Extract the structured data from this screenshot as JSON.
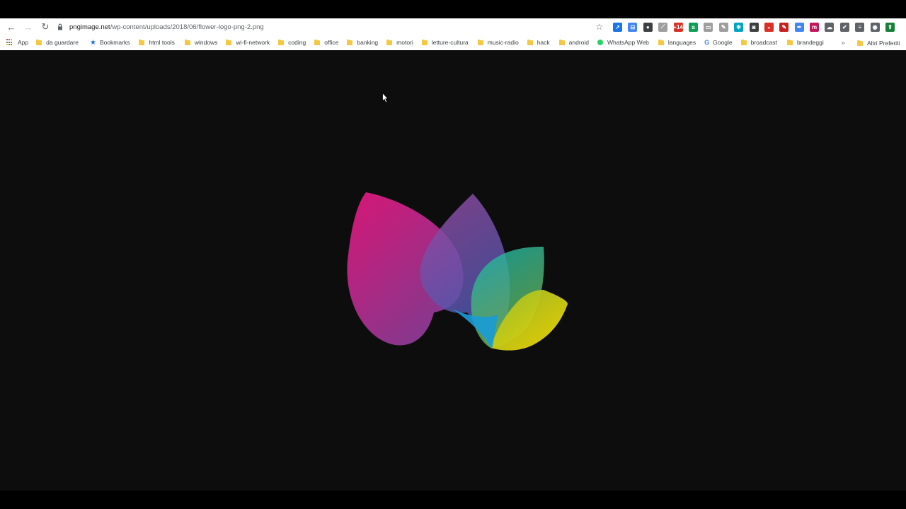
{
  "browser": {
    "url_host": "pngimage.net",
    "url_path": "/wp-content/uploads/2018/06/flower-logo-png-2.png"
  },
  "extensions": [
    {
      "name": "arrow-ext-icon",
      "color": "#1a73e8",
      "glyph": "↗"
    },
    {
      "name": "doc-ext-icon",
      "color": "#4285f4",
      "glyph": "⊟"
    },
    {
      "name": "circle-ext-icon",
      "color": "#3c4043",
      "glyph": "●"
    },
    {
      "name": "pdf-ext-icon",
      "color": "#9e9e9e",
      "glyph": "⟋"
    },
    {
      "name": "badge-ext-icon",
      "color": "#d93025",
      "glyph": "+14"
    },
    {
      "name": "a-ext-icon",
      "color": "#0f9d58",
      "glyph": "a"
    },
    {
      "name": "screen-ext-icon",
      "color": "#9e9e9e",
      "glyph": "▭"
    },
    {
      "name": "pen-ext-icon",
      "color": "#9e9e9e",
      "glyph": "✎"
    },
    {
      "name": "react-ext-icon",
      "color": "#00a3c4",
      "glyph": "✻"
    },
    {
      "name": "camera-ext-icon",
      "color": "#3c4043",
      "glyph": "◙"
    },
    {
      "name": "pokeball-ext-icon",
      "color": "#d93025",
      "glyph": "◒"
    },
    {
      "name": "acrobat-ext-icon",
      "color": "#c5221f",
      "glyph": "✎"
    },
    {
      "name": "feather-ext-icon",
      "color": "#4285f4",
      "glyph": "✒"
    },
    {
      "name": "m-ext-icon",
      "color": "#c2185b",
      "glyph": "m"
    },
    {
      "name": "cloud-ext-icon",
      "color": "#5f6368",
      "glyph": "☁"
    },
    {
      "name": "check-ext-icon",
      "color": "#5f6368",
      "glyph": "✔"
    },
    {
      "name": "list-ext-icon",
      "color": "#5f6368",
      "glyph": "≡"
    },
    {
      "name": "profile-ext-icon",
      "color": "#5f6368",
      "glyph": "◉"
    },
    {
      "name": "update-ext-icon",
      "color": "#188038",
      "glyph": "⬆"
    }
  ],
  "bookmarks": {
    "apps": "App",
    "items": [
      {
        "label": "da guardare",
        "type": "folder"
      },
      {
        "label": "Bookmarks",
        "type": "star"
      },
      {
        "label": "html tools",
        "type": "folder"
      },
      {
        "label": "windows",
        "type": "folder"
      },
      {
        "label": "wi-fi-network",
        "type": "folder"
      },
      {
        "label": "coding",
        "type": "folder"
      },
      {
        "label": "office",
        "type": "folder"
      },
      {
        "label": "banking",
        "type": "folder"
      },
      {
        "label": "motori",
        "type": "folder"
      },
      {
        "label": "letture-cultura",
        "type": "folder"
      },
      {
        "label": "music-radio",
        "type": "folder"
      },
      {
        "label": "hack",
        "type": "folder"
      },
      {
        "label": "android",
        "type": "folder"
      },
      {
        "label": "WhatsApp Web",
        "type": "whatsapp"
      },
      {
        "label": "languages",
        "type": "folder"
      },
      {
        "label": "Google",
        "type": "google"
      },
      {
        "label": "broadcast",
        "type": "folder"
      },
      {
        "label": "brandeggi",
        "type": "folder"
      }
    ],
    "more": "»",
    "other": "Altri Preferiti"
  }
}
